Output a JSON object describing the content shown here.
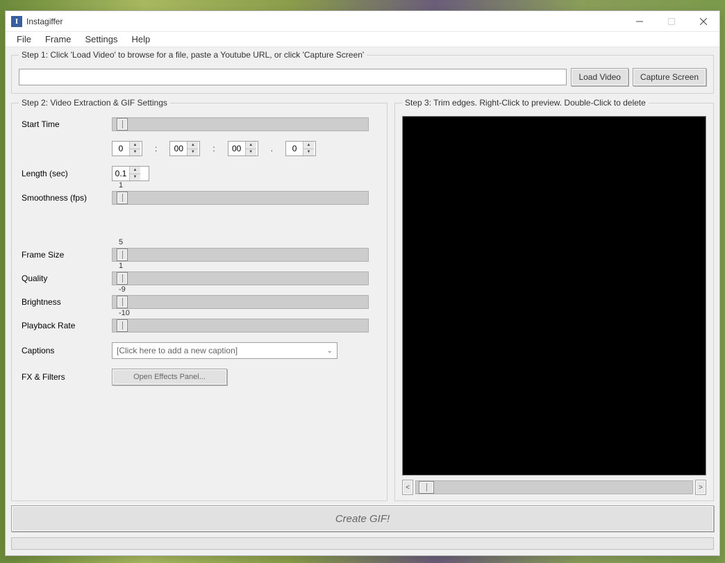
{
  "window": {
    "title": "Instagiffer"
  },
  "menu": [
    "File",
    "Frame",
    "Settings",
    "Help"
  ],
  "step1": {
    "legend": "Step 1: Click 'Load Video' to browse for a file, paste a Youtube URL, or click 'Capture Screen'",
    "url_value": "",
    "load_video": "Load Video",
    "capture_screen": "Capture Screen"
  },
  "step2": {
    "legend": "Step 2: Video Extraction & GIF Settings",
    "labels": {
      "start_time": "Start Time",
      "length": "Length (sec)",
      "smoothness": "Smoothness (fps)",
      "frame_size": "Frame Size",
      "quality": "Quality",
      "brightness": "Brightness",
      "playback": "Playback Rate",
      "captions": "Captions",
      "fx": "FX & Filters"
    },
    "time": {
      "h": "0",
      "m": "00",
      "s": "00",
      "ms": "0"
    },
    "length_value": "0.1",
    "slider_values": {
      "smoothness": "1",
      "frame_size": "5",
      "quality": "1",
      "brightness": "-9",
      "playback": "-10"
    },
    "captions_placeholder": "[Click here to add a new caption]",
    "fx_button": "Open Effects Panel..."
  },
  "step3": {
    "legend": "Step 3: Trim edges. Right-Click to preview. Double-Click to delete",
    "prev": "<",
    "next": ">"
  },
  "create_button": "Create GIF!"
}
